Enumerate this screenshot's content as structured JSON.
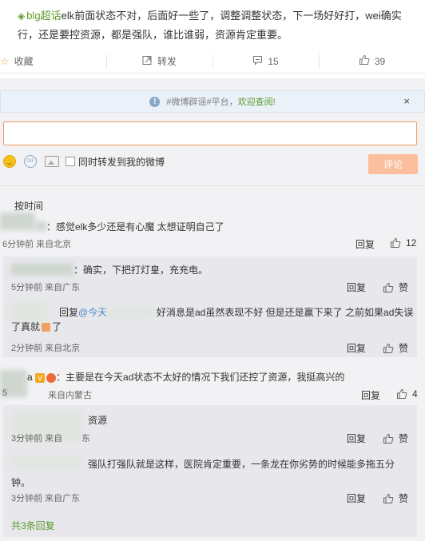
{
  "post": {
    "topic_icon": "diamond-icon",
    "topic": "blg超话",
    "text": "elk前面状态不对，后面好一些了，调整调整状态，下一场好好打，wei确实行，还是要控资源，都是强队，谁比谁弱，资源肯定重要。"
  },
  "actions": {
    "favorite": "收藏",
    "repost": "转发",
    "comment_count": "15",
    "like_count": "39"
  },
  "notice": {
    "prefix": "#微博辟谣#平台，",
    "highlight": "欢迎查阅!",
    "close": "×"
  },
  "composer": {
    "input_value": "",
    "sync_label": "同时转发到我的微博",
    "submit": "评论",
    "gif_label": "GIF"
  },
  "sort_label": "按时间",
  "comments": [
    {
      "text": "：感觉elk多少还是有心魔 太想证明自己了",
      "meta": "6分钟前 来自北京",
      "reply": "回复",
      "likes": "12"
    },
    {
      "text": "：确实，下把打灯皇，充充电。",
      "meta": "5分钟前 来自广东",
      "reply": "回复",
      "likes": "赞"
    },
    {
      "text_prefix": "回复",
      "mention": "@今天",
      "text": "好消息是ad虽然表现不好 但是还是赢下来了 之前如果ad失误了真就",
      "text_suffix": "了",
      "meta": "2分钟前 来自北京",
      "reply": "回复",
      "likes": "赞"
    },
    {
      "name_char": "a",
      "badge_v": "V",
      "text": "：主要是在今天ad状态不太好的情况下我们还控了资源，我挺高兴的",
      "meta": "来自内蒙古",
      "meta_prefix": "5",
      "reply": "回复",
      "likes": "4"
    },
    {
      "text": "资源",
      "meta_prefix": "3分钟前 来自",
      "meta_suffix": "东",
      "reply": "回复",
      "likes": "赞"
    },
    {
      "text": "强队打强队就是这样，医院肯定重要，一条龙在你劣势的时候能多拖五分钟。",
      "meta": "3分钟前 来自广东",
      "reply": "回复",
      "likes": "赞"
    }
  ],
  "total_replies": "共3条回复",
  "colors": {
    "topic_green": "#5c9a2c",
    "mention_blue": "#4d88c6",
    "input_border": "#f29b5c",
    "submit_bg": "#fbbf9d",
    "comment_bg": "#f2f2f5"
  }
}
